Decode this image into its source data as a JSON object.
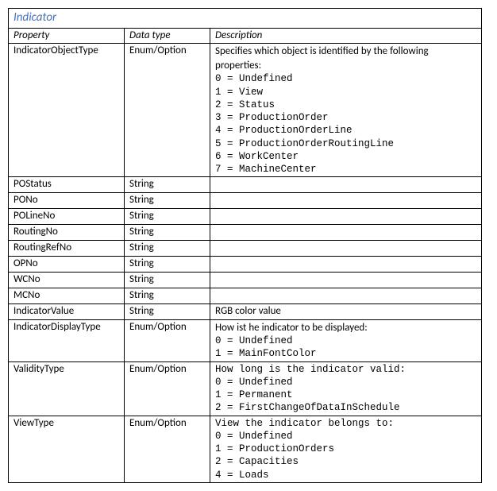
{
  "title": "Indicator",
  "headers": {
    "property": "Property",
    "datatype": "Data type",
    "description": "Description"
  },
  "rows": {
    "indicatorObjectType": {
      "property": "IndicatorObjectType",
      "datatype": "Enum/Option",
      "desc_intro": "Specifies which object is identified by the following properties:",
      "enum0": "0 = Undefined",
      "enum1": "1 = View",
      "enum2": "2 = Status",
      "enum3": "3 = ProductionOrder",
      "enum4": "4 = ProductionOrderLine",
      "enum5": "5 = ProductionOrderRoutingLine",
      "enum6": "6 = WorkCenter",
      "enum7": "7 = MachineCenter"
    },
    "poStatus": {
      "property": "POStatus",
      "datatype": "String",
      "description": ""
    },
    "poNo": {
      "property": "PONo",
      "datatype": "String",
      "description": ""
    },
    "poLineNo": {
      "property": "POLineNo",
      "datatype": "String",
      "description": ""
    },
    "routingNo": {
      "property": "RoutingNo",
      "datatype": "String",
      "description": ""
    },
    "routingRefNo": {
      "property": "RoutingRefNo",
      "datatype": "String",
      "description": ""
    },
    "opNo": {
      "property": "OPNo",
      "datatype": "String",
      "description": ""
    },
    "wcNo": {
      "property": "WCNo",
      "datatype": "String",
      "description": ""
    },
    "mcNo": {
      "property": "MCNo",
      "datatype": "String",
      "description": ""
    },
    "indicatorValue": {
      "property": "IndicatorValue",
      "datatype": "String",
      "description": "RGB color value"
    },
    "indicatorDisplayType": {
      "property": "IndicatorDisplayType",
      "datatype": "Enum/Option",
      "desc_intro": "How ist he indicator to be displayed:",
      "enum0": "0 = Undefined",
      "enum1": "1 = MainFontColor"
    },
    "validityType": {
      "property": "ValidityType",
      "datatype": "Enum/Option",
      "desc_intro": "How long is the indicator valid:",
      "enum0": "0 = Undefined",
      "enum1": "1 = Permanent",
      "enum2": "2 = FirstChangeOfDataInSchedule"
    },
    "viewType": {
      "property": "ViewType",
      "datatype": "Enum/Option",
      "desc_intro": "View the indicator belongs to:",
      "enum0": "0 = Undefined",
      "enum1": "1 = ProductionOrders",
      "enum2": "2 = Capacities",
      "enum3": "4 = Loads"
    }
  }
}
